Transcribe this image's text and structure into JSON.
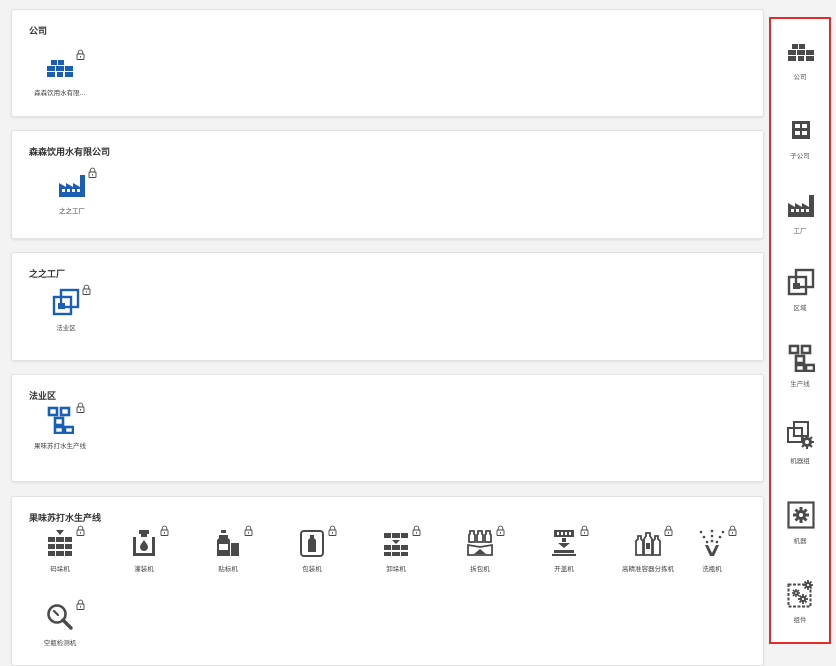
{
  "cards": [
    {
      "title": "公司",
      "items": [
        {
          "label": "森森饮用水有限...",
          "icon": "company-icon"
        }
      ]
    },
    {
      "title": "森森饮用水有限公司",
      "items": [
        {
          "label": "之之工厂",
          "icon": "factory-icon"
        }
      ]
    },
    {
      "title": "之之工厂",
      "items": [
        {
          "label": "法业区",
          "icon": "area-icon"
        }
      ]
    },
    {
      "title": "法业区",
      "items": [
        {
          "label": "果味苏打水生产线",
          "icon": "production-line-icon"
        }
      ]
    },
    {
      "title": "果味苏打水生产线",
      "items": [
        {
          "label": "码垛机",
          "icon": "palletizer-icon"
        },
        {
          "label": "灌装机",
          "icon": "filling-machine-icon"
        },
        {
          "label": "贴标机",
          "icon": "labeling-machine-icon"
        },
        {
          "label": "包装机",
          "icon": "packaging-machine-icon"
        },
        {
          "label": "卸垛机",
          "icon": "depalletizer-icon"
        },
        {
          "label": "拆包机",
          "icon": "unpacking-machine-icon"
        },
        {
          "label": "开盖机",
          "icon": "cap-opener-icon"
        },
        {
          "label": "高精准容器分拣机",
          "icon": "container-sorter-icon"
        },
        {
          "label": "洗瓶机",
          "icon": "bottle-washer-icon"
        },
        {
          "label": "空瓶检测机",
          "icon": "empty-bottle-inspector-icon"
        }
      ]
    }
  ],
  "sidebar": [
    {
      "label": "公司",
      "icon": "company-icon"
    },
    {
      "label": "子公司",
      "icon": "subsidiary-icon"
    },
    {
      "label": "工厂",
      "icon": "factory-icon"
    },
    {
      "label": "区域",
      "icon": "area-icon"
    },
    {
      "label": "生产线",
      "icon": "production-line-icon"
    },
    {
      "label": "机器组",
      "icon": "machine-group-icon"
    },
    {
      "label": "机器",
      "icon": "machine-icon"
    },
    {
      "label": "组件",
      "icon": "component-icon"
    }
  ],
  "colors": {
    "accent_blue": "#1a5fb4",
    "icon_grey": "#4a4a4a",
    "highlight_border": "#e32b2b"
  }
}
